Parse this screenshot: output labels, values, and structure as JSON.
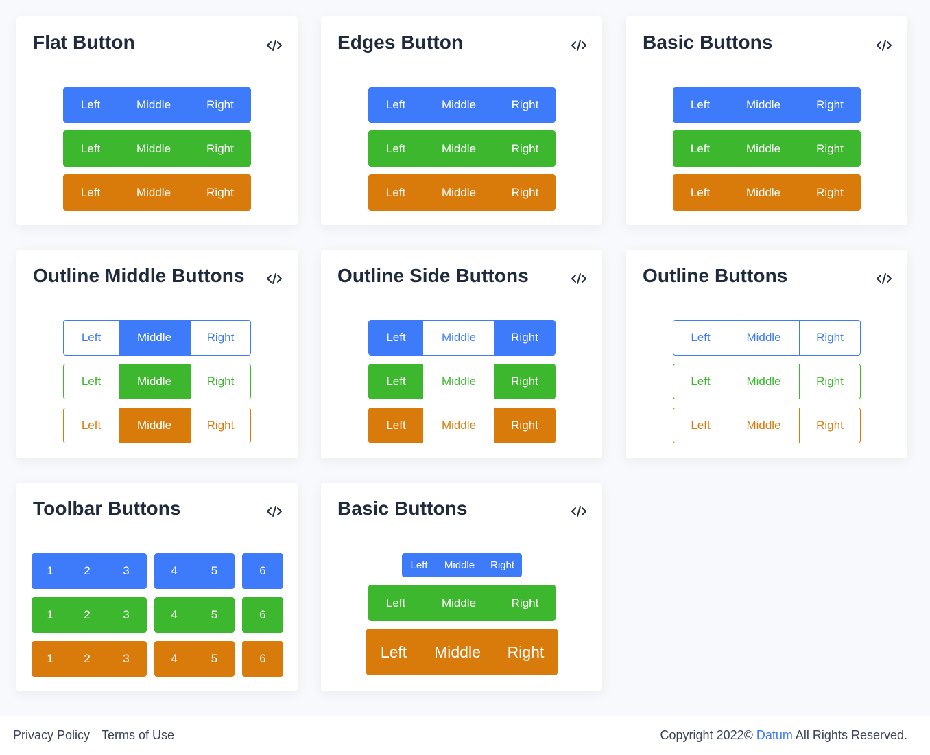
{
  "code_icon": "code-icon",
  "colors": {
    "blue": "#3d7bfa",
    "green": "#3db72d",
    "orange": "#d97b0b"
  },
  "labels": {
    "left": "Left",
    "middle": "Middle",
    "right": "Right"
  },
  "cards": {
    "flat": {
      "title": "Flat Button"
    },
    "edges": {
      "title": "Edges Button"
    },
    "basic": {
      "title": "Basic Buttons"
    },
    "outline_middle": {
      "title": "Outline Middle Buttons"
    },
    "outline_side": {
      "title": "Outline Side Buttons"
    },
    "outline": {
      "title": "Outline Buttons"
    },
    "toolbar": {
      "title": "Toolbar Buttons",
      "numbers": [
        "1",
        "2",
        "3",
        "4",
        "5",
        "6"
      ]
    },
    "basic_sizes": {
      "title": "Basic Buttons"
    }
  },
  "footer": {
    "privacy": "Privacy Policy",
    "terms": "Terms of Use",
    "copyright_prefix": "Copyright 2022©",
    "brand": "Datum",
    "copyright_suffix": "All Rights Reserved."
  }
}
